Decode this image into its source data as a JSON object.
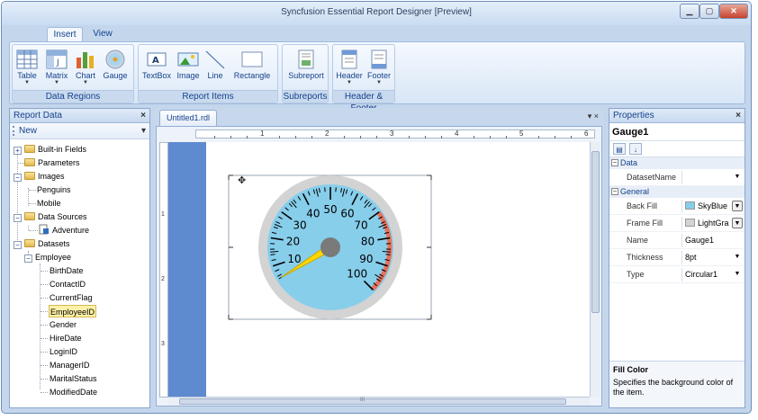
{
  "window": {
    "title": "Syncfusion Essential Report Designer [Preview]",
    "minimize": "▁",
    "maximize": "▢",
    "close": "✕"
  },
  "ribbon": {
    "tabs": [
      {
        "label": "Insert"
      },
      {
        "label": "View"
      }
    ],
    "groups": {
      "data_regions": {
        "label": "Data Regions",
        "items": [
          "Table",
          "Matrix",
          "Chart",
          "Gauge"
        ]
      },
      "report_items": {
        "label": "Report Items",
        "items": [
          "TextBox",
          "Image",
          "Line",
          "Rectangle"
        ]
      },
      "subreports": {
        "label": "Subreports",
        "items": [
          "Subreport"
        ]
      },
      "header_footer": {
        "label": "Header & Footer",
        "items": [
          "Header",
          "Footer"
        ]
      }
    }
  },
  "report_data": {
    "title": "Report Data",
    "close": "×",
    "new_label": "New",
    "tree": {
      "builtin": "Built-in Fields",
      "parameters": "Parameters",
      "images": "Images",
      "image_items": [
        "Penguins",
        "Mobile"
      ],
      "data_sources": "Data Sources",
      "data_source_items": [
        "Adventure"
      ],
      "datasets": "Datasets",
      "dataset": "Employee",
      "fields": [
        "BirthDate",
        "ContactID",
        "CurrentFlag",
        "EmployeeID",
        "Gender",
        "HireDate",
        "LoginID",
        "ManagerID",
        "MaritalStatus",
        "ModifiedDate"
      ]
    }
  },
  "document": {
    "tab": "Untitled1.rdl",
    "tab_controls": "▾ ×",
    "ruler_top": [
      "1",
      "2",
      "3",
      "4",
      "5",
      "6"
    ],
    "ruler_left": [
      "1",
      "2",
      "3"
    ],
    "scroll_mark": "III"
  },
  "gauge": {
    "labels": [
      "10",
      "20",
      "30",
      "40",
      "50",
      "60",
      "70",
      "80",
      "90",
      "100"
    ],
    "needle_value": 5,
    "range_start": 70,
    "range_end": 100,
    "face_color": "#87ceeb",
    "range_color": "#e9705a",
    "needle_color": "#ffd700",
    "move_icon": "✥"
  },
  "properties": {
    "title": "Properties",
    "close": "×",
    "selected": "Gauge1",
    "categories": [
      {
        "name": "Data",
        "rows": [
          {
            "key": "DatasetName",
            "value": ""
          }
        ]
      },
      {
        "name": "General",
        "rows": [
          {
            "key": "Back Fill",
            "value": "SkyBlue",
            "swatch": "#87ceeb"
          },
          {
            "key": "Frame Fill",
            "value": "LightGra",
            "swatch": "#d3d3d3"
          },
          {
            "key": "Name",
            "value": "Gauge1"
          },
          {
            "key": "Thickness",
            "value": "8pt"
          },
          {
            "key": "Type",
            "value": "Circular1"
          }
        ]
      }
    ],
    "desc_title": "Fill Color",
    "desc_text": "Specifies the background color of the item."
  }
}
